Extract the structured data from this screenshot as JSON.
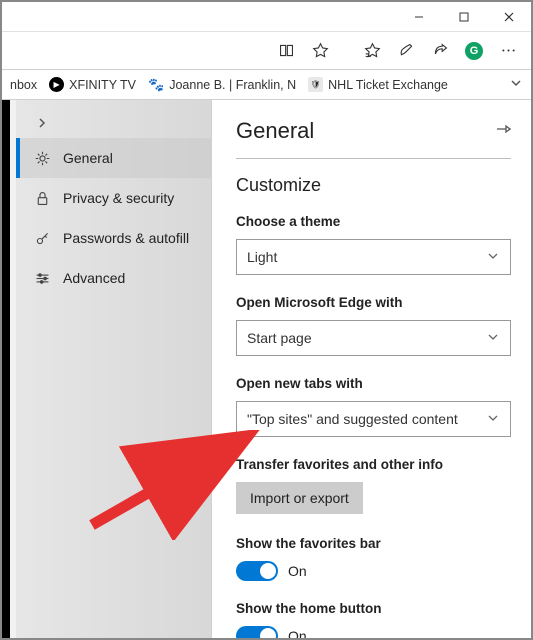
{
  "window": {
    "minimize": "–",
    "maximize": "❐",
    "close": "✕"
  },
  "bookmarks": {
    "inbox": "nbox",
    "xfinity": "XFINITY TV",
    "joanne": "Joanne B. | Franklin, N",
    "nhl": "NHL Ticket Exchange"
  },
  "sidebar": {
    "items": [
      {
        "label": "General"
      },
      {
        "label": "Privacy & security"
      },
      {
        "label": "Passwords & autofill"
      },
      {
        "label": "Advanced"
      }
    ]
  },
  "content": {
    "title": "General",
    "customize": "Customize",
    "theme_label": "Choose a theme",
    "theme_value": "Light",
    "open_with_label": "Open Microsoft Edge with",
    "open_with_value": "Start page",
    "new_tabs_label": "Open new tabs with",
    "new_tabs_value": "\"Top sites\" and suggested content",
    "transfer_label": "Transfer favorites and other info",
    "import_btn": "Import or export",
    "fav_bar_label": "Show the favorites bar",
    "fav_bar_state": "On",
    "home_btn_label": "Show the home button",
    "home_btn_state": "On"
  }
}
